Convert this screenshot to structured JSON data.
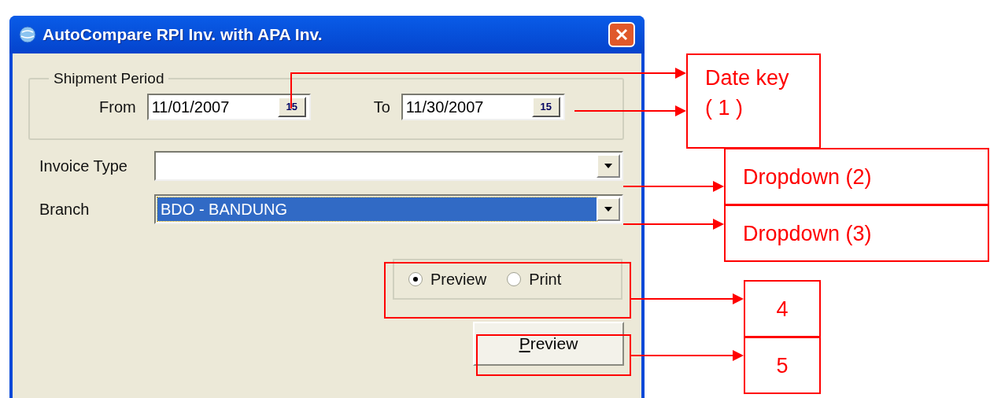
{
  "window": {
    "title": "AutoCompare RPI Inv. with APA Inv."
  },
  "shipment_period": {
    "label": "Shipment Period",
    "fields": [
      {
        "label": "From",
        "value": "11/01/2007",
        "button": "15"
      },
      {
        "label": "To",
        "value": "11/30/2007",
        "button": "15"
      }
    ]
  },
  "combos": [
    {
      "label": "Invoice Type",
      "selected": false
    },
    {
      "label": "Branch",
      "value": "BDO - BANDUNG",
      "selected": true
    }
  ],
  "output_mode": [
    {
      "label": "Preview",
      "selected": true
    },
    {
      "label": "Print",
      "selected": false
    }
  ],
  "action_button": {
    "label": "Preview"
  },
  "callouts": [
    {
      "text": "Date key\n( 1 )"
    },
    {
      "text": "Dropdown (2)"
    },
    {
      "text": "Dropdown (3)"
    },
    {
      "text": "4"
    },
    {
      "text": "5"
    }
  ]
}
